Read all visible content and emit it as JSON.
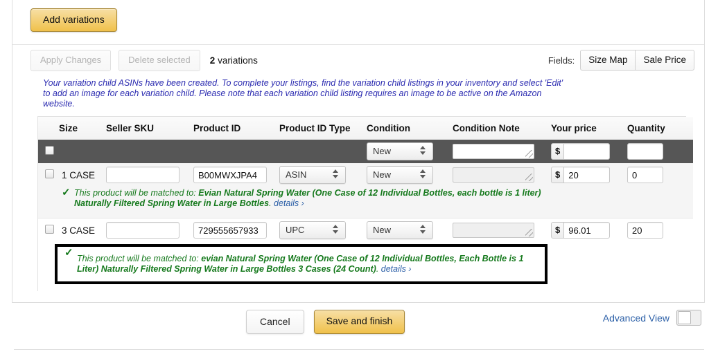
{
  "top_panel": {
    "add_variations_label": "Add variations"
  },
  "toolbar": {
    "apply_changes_label": "Apply Changes",
    "delete_selected_label": "Delete selected",
    "count_number": "2",
    "count_suffix": " variations",
    "fields_label": "Fields:",
    "field_buttons": [
      {
        "label": "Size Map"
      },
      {
        "label": "Sale Price"
      }
    ]
  },
  "notice": {
    "text": "Your variation child ASINs have been created. To complete your listings, find the variation child listings in your inventory and select 'Edit' to add an image for each variation child. Please note that each variation child listing requires an image to be active on the Amazon website.",
    "color": "#2a2ab0"
  },
  "table": {
    "headers": {
      "size": "Size",
      "seller_sku": "Seller SKU",
      "product_id": "Product ID",
      "product_id_type": "Product ID Type",
      "condition": "Condition",
      "condition_note": "Condition Note",
      "your_price": "Your price",
      "quantity": "Quantity"
    },
    "bulk_row": {
      "condition_value": "New",
      "condition_note_value": "",
      "currency_symbol": "$",
      "price_value": "",
      "price_placeholder": "",
      "quantity_value": "",
      "quantity_placeholder": ""
    },
    "rows": [
      {
        "size": "1 CASE",
        "seller_sku": "",
        "product_id": "B00MWXJPA4",
        "product_id_type": "ASIN",
        "condition": "New",
        "condition_note": "",
        "currency_symbol": "$",
        "price": "20",
        "quantity": "0",
        "match": {
          "prefix": "This product will be matched to: ",
          "product_name": "Evian Natural Spring Water (One Case of 12 Individual Bottles, each bottle is 1 liter) Naturally Filtered Spring Water in Large Bottles",
          "suffix": ".",
          "details_label": "details ›",
          "highlighted": false
        }
      },
      {
        "size": "3 CASE",
        "seller_sku": "",
        "product_id": "729555657933",
        "product_id_type": "UPC",
        "condition": "New",
        "condition_note": "",
        "currency_symbol": "$",
        "price": "96.01",
        "quantity": "20",
        "match": {
          "prefix": "This product will be matched to: ",
          "product_name": "evian Natural Spring Water (One Case of 12 Individual Bottles, Each Bottle is 1 Liter) Naturally Filtered Spring Water in Large Bottles 3 Cases (24 Count)",
          "suffix": ".",
          "details_label": "details ›",
          "highlighted": true
        }
      }
    ],
    "checkmark_glyph": "✓"
  },
  "footer": {
    "cancel_label": "Cancel",
    "save_label": "Save and finish",
    "advanced_view_label": "Advanced View",
    "advanced_view_on": false
  },
  "colors": {
    "gold": "#f0c14b",
    "match_green": "#15791c",
    "link_blue": "#2b5fa7",
    "dark_row": "#565656"
  }
}
